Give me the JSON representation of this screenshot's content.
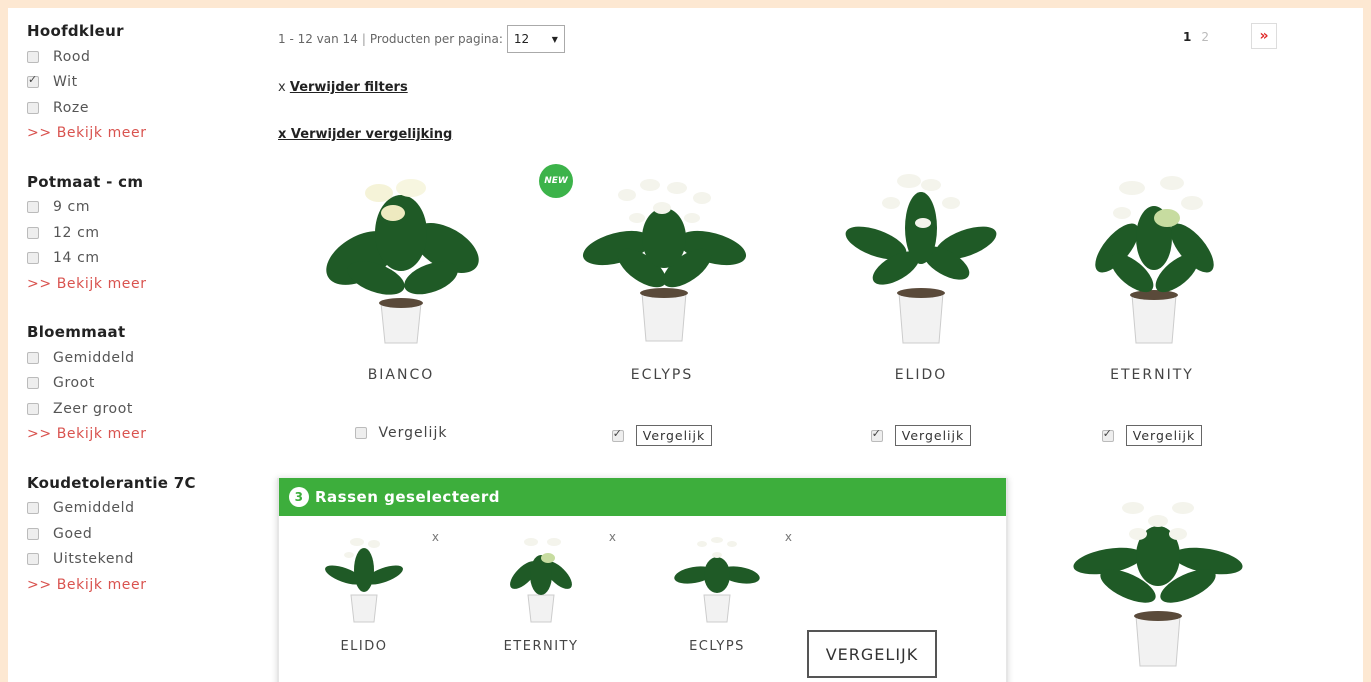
{
  "filters": [
    {
      "title": "Hoofdkleur",
      "options": [
        {
          "label": "Rood",
          "checked": false
        },
        {
          "label": "Wit",
          "checked": true
        },
        {
          "label": "Roze",
          "checked": false
        }
      ],
      "more": ">> Bekijk meer"
    },
    {
      "title": "Potmaat - cm",
      "options": [
        {
          "label": "9 cm",
          "checked": false
        },
        {
          "label": "12 cm",
          "checked": false
        },
        {
          "label": "14 cm",
          "checked": false
        }
      ],
      "more": ">> Bekijk meer"
    },
    {
      "title": "Bloemmaat",
      "options": [
        {
          "label": "Gemiddeld",
          "checked": false
        },
        {
          "label": "Groot",
          "checked": false
        },
        {
          "label": "Zeer groot",
          "checked": false
        }
      ],
      "more": ">> Bekijk meer"
    },
    {
      "title": "Koudetolerantie 7C",
      "options": [
        {
          "label": "Gemiddeld",
          "checked": false
        },
        {
          "label": "Goed",
          "checked": false
        },
        {
          "label": "Uitstekend",
          "checked": false
        }
      ],
      "more": ">> Bekijk meer"
    }
  ],
  "toolbar": {
    "range": "1 - 12 van 14",
    "separator": "|",
    "per_page_label": "Producten per pagina:",
    "per_page_value": "12"
  },
  "pagination": {
    "current": "1",
    "next_page": "2",
    "next_icon": "»"
  },
  "remove_filters": {
    "x": "x",
    "label": "Verwijder filters"
  },
  "remove_compare": {
    "label": "x Verwijder vergelijking"
  },
  "new_badge": "NEW",
  "products": [
    {
      "name": "BIANCO",
      "compare_label": "Vergelijk",
      "checked": false
    },
    {
      "name": "ECLYPS",
      "compare_label": "Vergelijk",
      "checked": true
    },
    {
      "name": "ELIDO",
      "compare_label": "Vergelijk",
      "checked": true
    },
    {
      "name": "ETERNITY",
      "compare_label": "Vergelijk",
      "checked": true
    }
  ],
  "compare": {
    "count": "3",
    "title": "Rassen geselecteerd",
    "items": [
      {
        "name": "ELIDO",
        "remove": "x"
      },
      {
        "name": "ETERNITY",
        "remove": "x"
      },
      {
        "name": "ECLYPS",
        "remove": "x"
      }
    ],
    "button": "VERGELIJK"
  },
  "colors": {
    "accent_green": "#3dae3c",
    "link_red": "#d9534f",
    "pager_red": "#e02a2a",
    "page_bg": "#fde8d2"
  }
}
